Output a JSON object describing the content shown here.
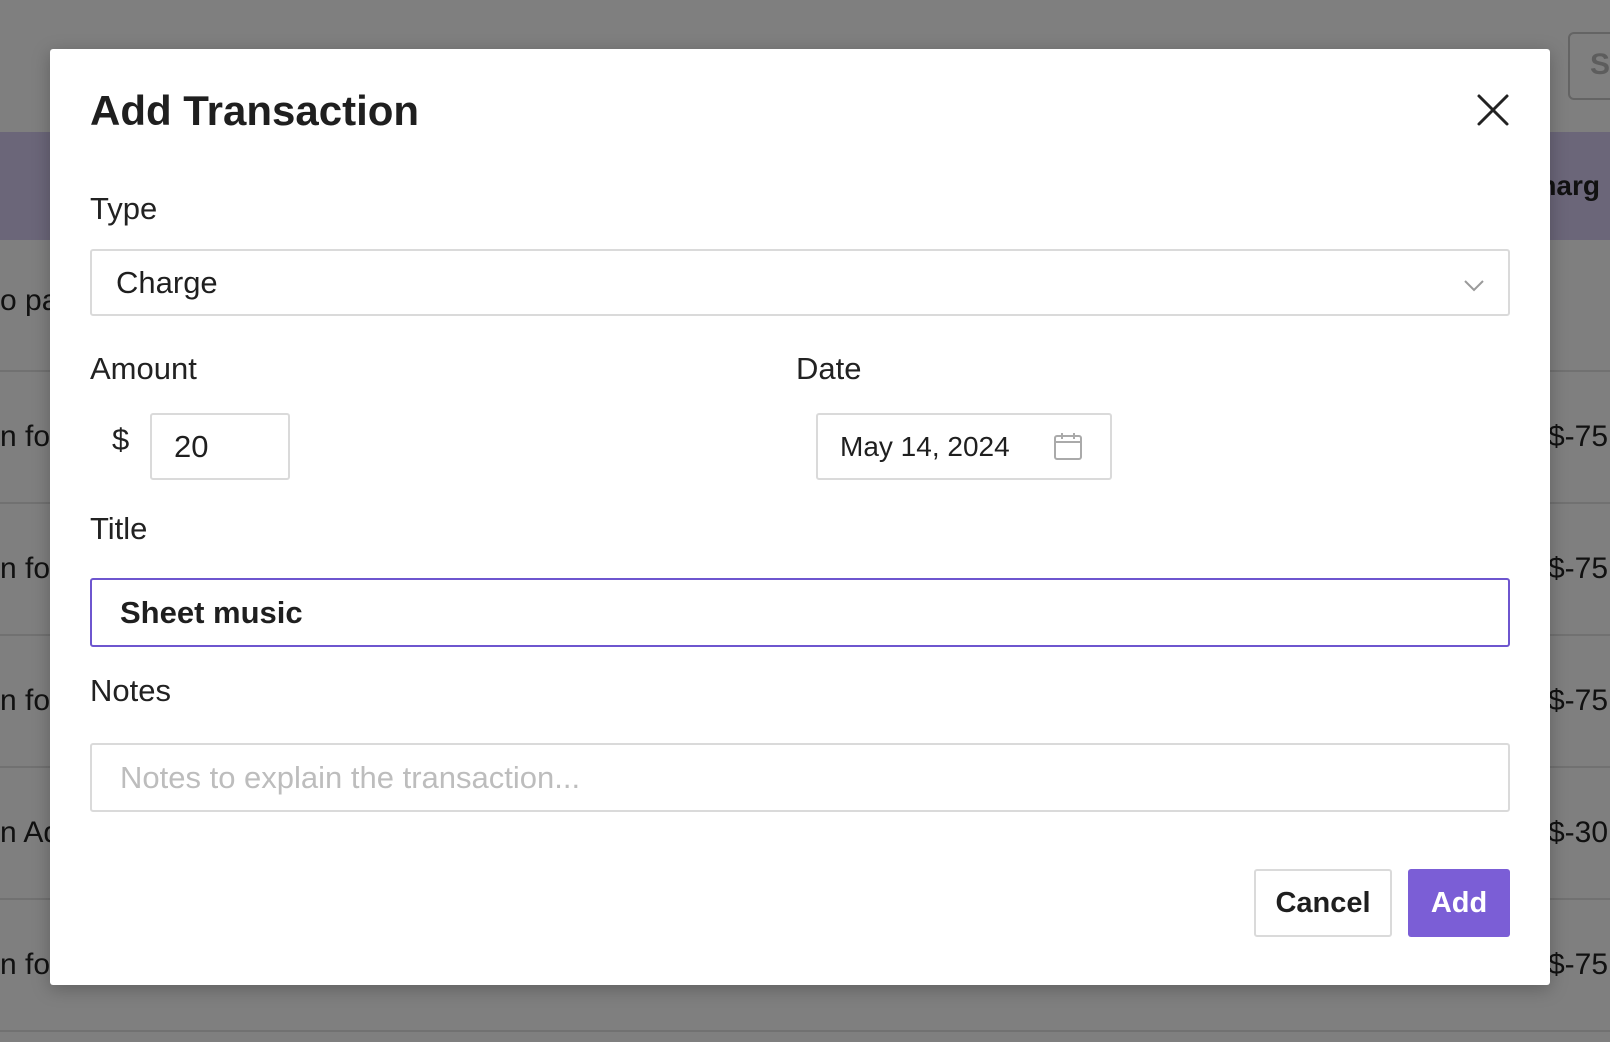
{
  "background": {
    "top_button_label": "S",
    "header_cell": "Charg",
    "rows": [
      {
        "left": "o pay",
        "right": ""
      },
      {
        "left": "n for",
        "right": "$-75"
      },
      {
        "left": "n for",
        "right": "$-75"
      },
      {
        "left": "n for",
        "right": "$-75"
      },
      {
        "left": "n Ad",
        "right": "$-30"
      },
      {
        "left": "n for",
        "right": "$-75"
      }
    ]
  },
  "modal": {
    "title": "Add Transaction",
    "close_icon": "close-icon",
    "type": {
      "label": "Type",
      "value": "Charge",
      "icon": "chevron-down-icon"
    },
    "amount": {
      "label": "Amount",
      "currency": "$",
      "value": "20"
    },
    "date": {
      "label": "Date",
      "value": "May 14, 2024",
      "icon": "calendar-icon"
    },
    "title_field": {
      "label": "Title",
      "value": "Sheet music"
    },
    "notes": {
      "label": "Notes",
      "value": "",
      "placeholder": "Notes to explain the transaction..."
    },
    "buttons": {
      "cancel": "Cancel",
      "add": "Add"
    }
  },
  "colors": {
    "accent": "#7b5ed6",
    "focus_border": "#6e56cf",
    "table_header_bg": "#d6ccf2"
  }
}
